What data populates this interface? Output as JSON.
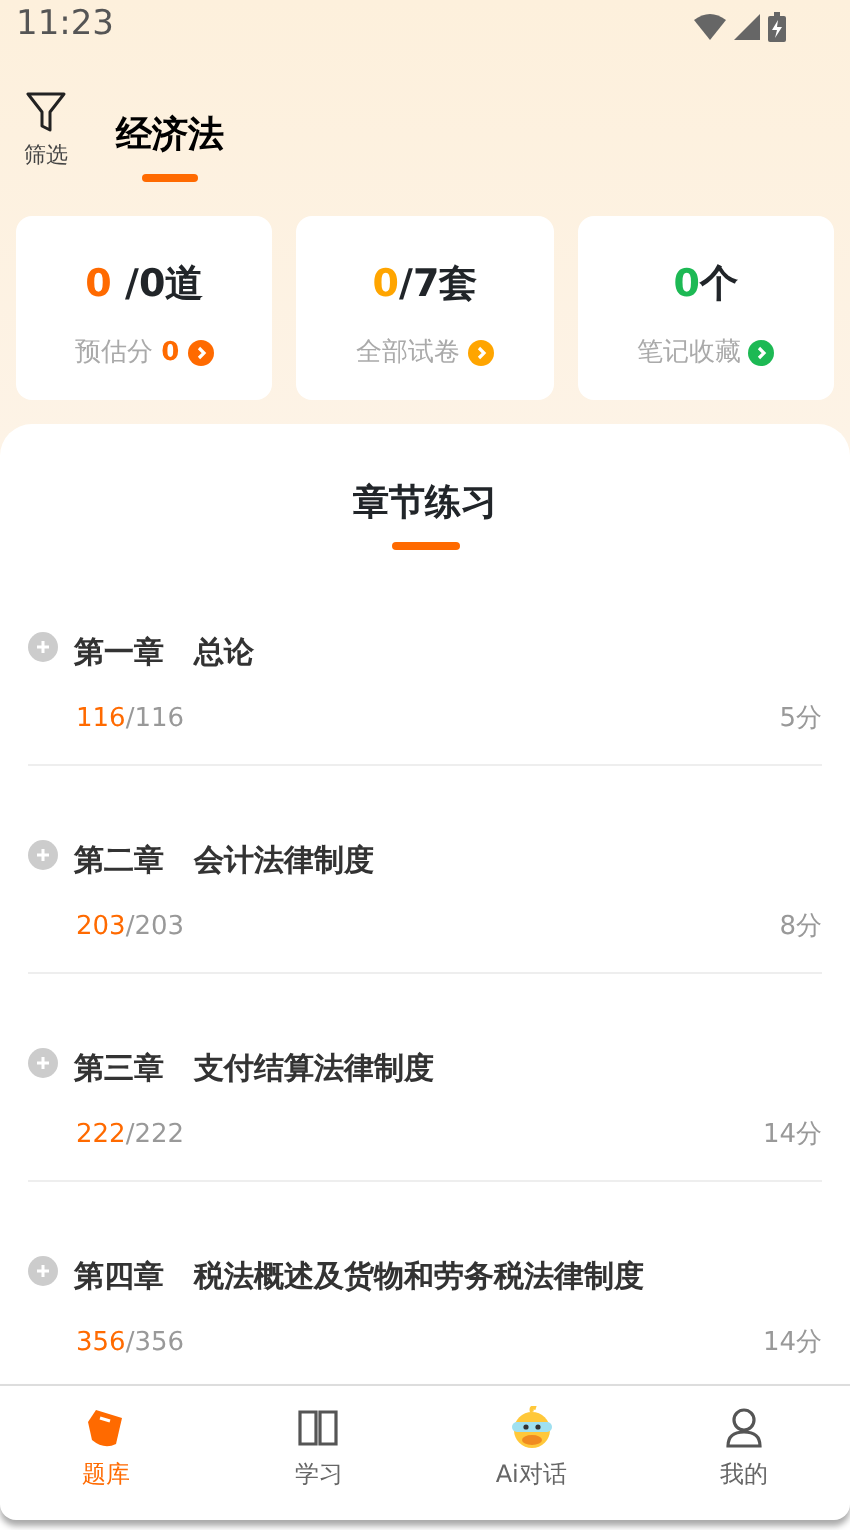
{
  "status_bar": {
    "time": "11:23"
  },
  "header": {
    "filter_label": "筛选",
    "tabs": [
      {
        "label": "经济法",
        "selected": true
      }
    ]
  },
  "stats": [
    {
      "value": "0",
      "unit": " /0道",
      "label": "预估分",
      "extra": "0",
      "color": "#ff6a00"
    },
    {
      "value": "0",
      "unit": "/7套",
      "label": "全部试卷",
      "color": "#ffa500"
    },
    {
      "value": "0",
      "unit": "个",
      "label": "笔记收藏",
      "color": "#1db954"
    }
  ],
  "section": {
    "title": "章节练习"
  },
  "chapters": [
    {
      "title": "第一章　总论",
      "done": "116",
      "total": "/116",
      "score": "5分"
    },
    {
      "title": "第二章　会计法律制度",
      "done": "203",
      "total": "/203",
      "score": "8分"
    },
    {
      "title": "第三章　支付结算法律制度",
      "done": "222",
      "total": "/222",
      "score": "14分"
    },
    {
      "title": "第四章　税法概述及货物和劳务税法律制度",
      "done": "356",
      "total": "/356",
      "score": "14分"
    }
  ],
  "nav": [
    {
      "label": "题库",
      "kind": "bank",
      "selected": true
    },
    {
      "label": "学习",
      "kind": "book",
      "selected": false
    },
    {
      "label": "Ai对话",
      "kind": "duck",
      "selected": false
    },
    {
      "label": "我的",
      "kind": "user",
      "selected": false
    }
  ]
}
